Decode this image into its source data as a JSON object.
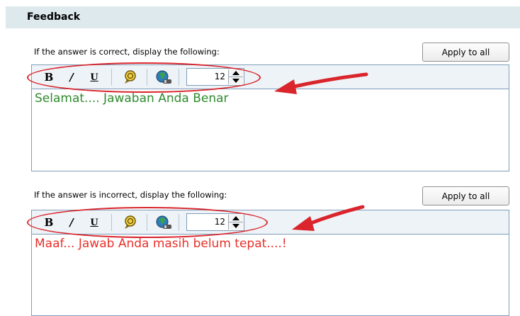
{
  "header": {
    "title": "Feedback"
  },
  "sections": [
    {
      "prompt": "If the answer is correct,  display the following:",
      "apply_label": "Apply to all",
      "font_size": "12",
      "text": "Selamat.... Jawaban Anda Benar",
      "text_color": "#2e8b2e"
    },
    {
      "prompt": "If the answer is incorrect,  display the following:",
      "apply_label": "Apply to all",
      "font_size": "12",
      "text": "Maaf... Jawab Anda masih belum tepat....!",
      "text_color": "#e8302a"
    }
  ],
  "toolbar": {
    "bold_glyph": "B",
    "italic_glyph": "/",
    "underline_glyph": "U",
    "tools": [
      "bold-icon",
      "italic-icon",
      "underline-icon",
      "spell-check-icon",
      "hyperlink-icon",
      "font-size-spinner"
    ]
  },
  "annotation_color": "#d9252b"
}
